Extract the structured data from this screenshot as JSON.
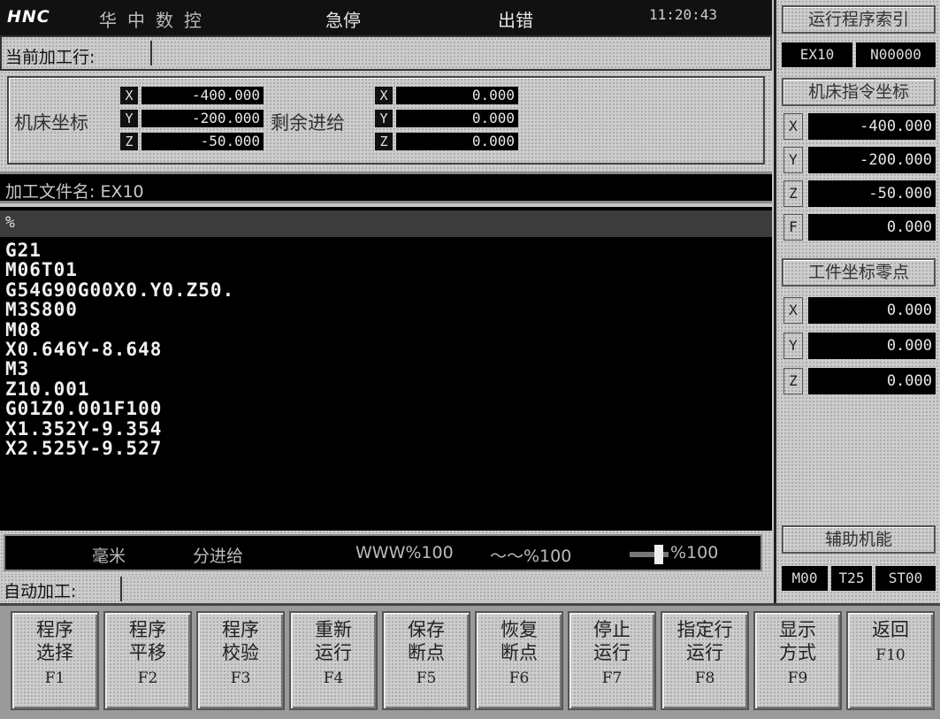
{
  "header": {
    "logo": "HNC",
    "brand": "华中数控",
    "mode": "急停",
    "error": "出错",
    "time": "11:20:43"
  },
  "current_line": {
    "label": "当前加工行:",
    "value": ""
  },
  "machine_coords": {
    "label": "机床坐标",
    "x_axis": "X",
    "x": "-400.000",
    "y_axis": "Y",
    "y": "-200.000",
    "z_axis": "Z",
    "z": "-50.000"
  },
  "remaining_feed": {
    "label": "剩余进给",
    "x_axis": "X",
    "x": "0.000",
    "y_axis": "Y",
    "y": "0.000",
    "z_axis": "Z",
    "z": "0.000"
  },
  "file": {
    "label": "加工文件名: EX10"
  },
  "program": {
    "header": "%",
    "lines": [
      "G21",
      "M06T01",
      "G54G90G00X0.Y0.Z50.",
      "M3S800",
      "M08",
      "X0.646Y-8.648",
      "M3",
      "Z10.001",
      "G01Z0.001F100",
      "X1.352Y-9.354",
      "X2.525Y-9.527"
    ]
  },
  "status": {
    "unit": "毫米",
    "feed_mode": "分进给",
    "feed_override": "WWW%100",
    "spindle_override": "〜〜%100",
    "rapid_override": "%100"
  },
  "auto": {
    "label": "自动加工:",
    "value": ""
  },
  "right_panel": {
    "run_index": {
      "title": "运行程序索引",
      "program": "EX10",
      "line": "N00000"
    },
    "machine_cmd": {
      "title": "机床指令坐标",
      "x_axis": "X",
      "x": "-400.000",
      "y_axis": "Y",
      "y": "-200.000",
      "z_axis": "Z",
      "z": "-50.000",
      "f_axis": "F",
      "f": "0.000"
    },
    "work_zero": {
      "title": "工件坐标零点",
      "x_axis": "X",
      "x": "0.000",
      "y_axis": "Y",
      "y": "0.000",
      "z_axis": "Z",
      "z": "0.000"
    },
    "aux": {
      "title": "辅助机能",
      "m": "M00",
      "t": "T25",
      "st": "ST00"
    }
  },
  "fkeys": [
    {
      "l1": "程序",
      "l2": "选择",
      "fn": "F1"
    },
    {
      "l1": "程序",
      "l2": "平移",
      "fn": "F2"
    },
    {
      "l1": "程序",
      "l2": "校验",
      "fn": "F3"
    },
    {
      "l1": "重新",
      "l2": "运行",
      "fn": "F4"
    },
    {
      "l1": "保存",
      "l2": "断点",
      "fn": "F5"
    },
    {
      "l1": "恢复",
      "l2": "断点",
      "fn": "F6"
    },
    {
      "l1": "停止",
      "l2": "运行",
      "fn": "F7"
    },
    {
      "l1": "指定行",
      "l2": "运行",
      "fn": "F8"
    },
    {
      "l1": "显示",
      "l2": "方式",
      "fn": "F9"
    },
    {
      "l1": "返回",
      "l2": "",
      "fn": "F10"
    }
  ]
}
